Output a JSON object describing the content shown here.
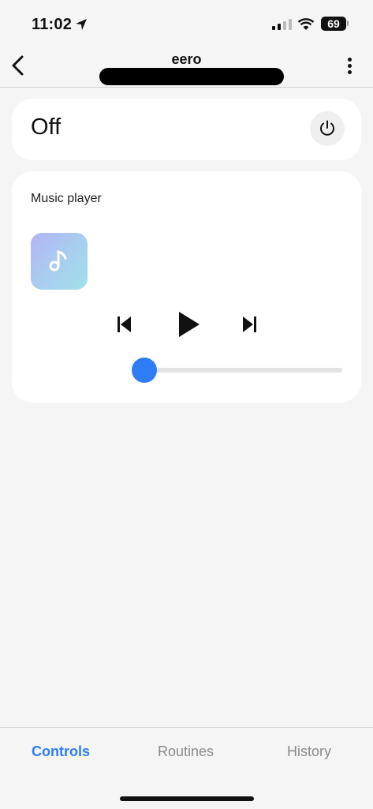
{
  "status_bar": {
    "time": "11:02",
    "battery": "69",
    "icons": [
      "location-arrow-icon",
      "cellular-signal-icon",
      "wifi-icon",
      "battery-icon"
    ]
  },
  "header": {
    "title": "eero",
    "back_icon": "chevron-left-icon",
    "menu_icon": "more-vertical-icon"
  },
  "power": {
    "state": "Off",
    "icon": "power-icon"
  },
  "music_player": {
    "title": "Music player",
    "artwork_icon": "music-note-icon",
    "controls": [
      "skip-previous-icon",
      "play-icon",
      "skip-next-icon"
    ],
    "volume_fraction": 0.0
  },
  "tabs": [
    {
      "label": "Controls",
      "active": true
    },
    {
      "label": "Routines",
      "active": false
    },
    {
      "label": "History",
      "active": false
    }
  ],
  "colors": {
    "accent": "#2e7cf6",
    "background": "#f5f5f5",
    "card": "#ffffff",
    "inactive_tab": "#8a8a8a"
  }
}
